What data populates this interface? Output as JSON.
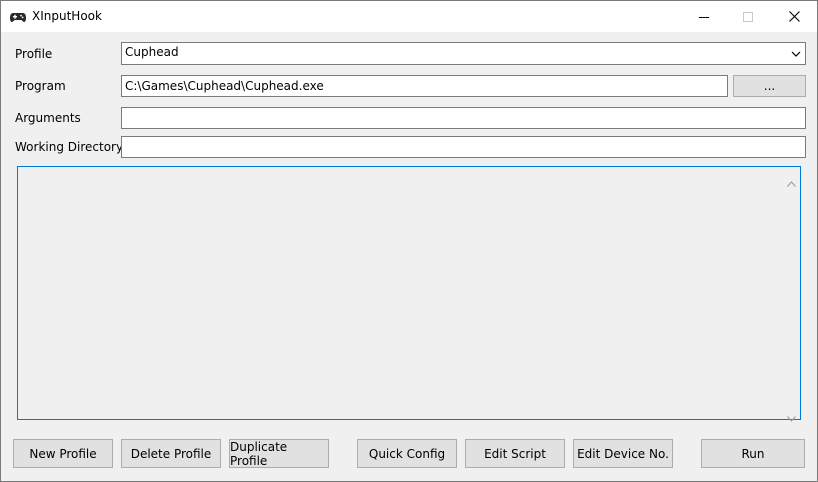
{
  "window": {
    "title": "XInputHook",
    "icons": {
      "app": "gamepad-icon",
      "minimize": "minimize-icon",
      "maximize": "maximize-icon",
      "close": "close-icon"
    }
  },
  "form": {
    "profile_label": "Profile",
    "profile_value": "Cuphead",
    "program_label": "Program",
    "program_value": "C:\\Games\\Cuphead\\Cuphead.exe",
    "browse_label": "...",
    "arguments_label": "Arguments",
    "arguments_value": "",
    "workdir_label": "Working Directory",
    "workdir_value": ""
  },
  "buttons": {
    "new_profile": "New Profile",
    "delete_profile": "Delete Profile",
    "duplicate_profile": "Duplicate Profile",
    "quick_config": "Quick Config",
    "edit_script": "Edit Script",
    "edit_device_no": "Edit Device No.",
    "run": "Run"
  },
  "colors": {
    "accent": "#0078d7",
    "window_bg": "#f0f0f0",
    "button_bg": "#e1e1e1"
  }
}
